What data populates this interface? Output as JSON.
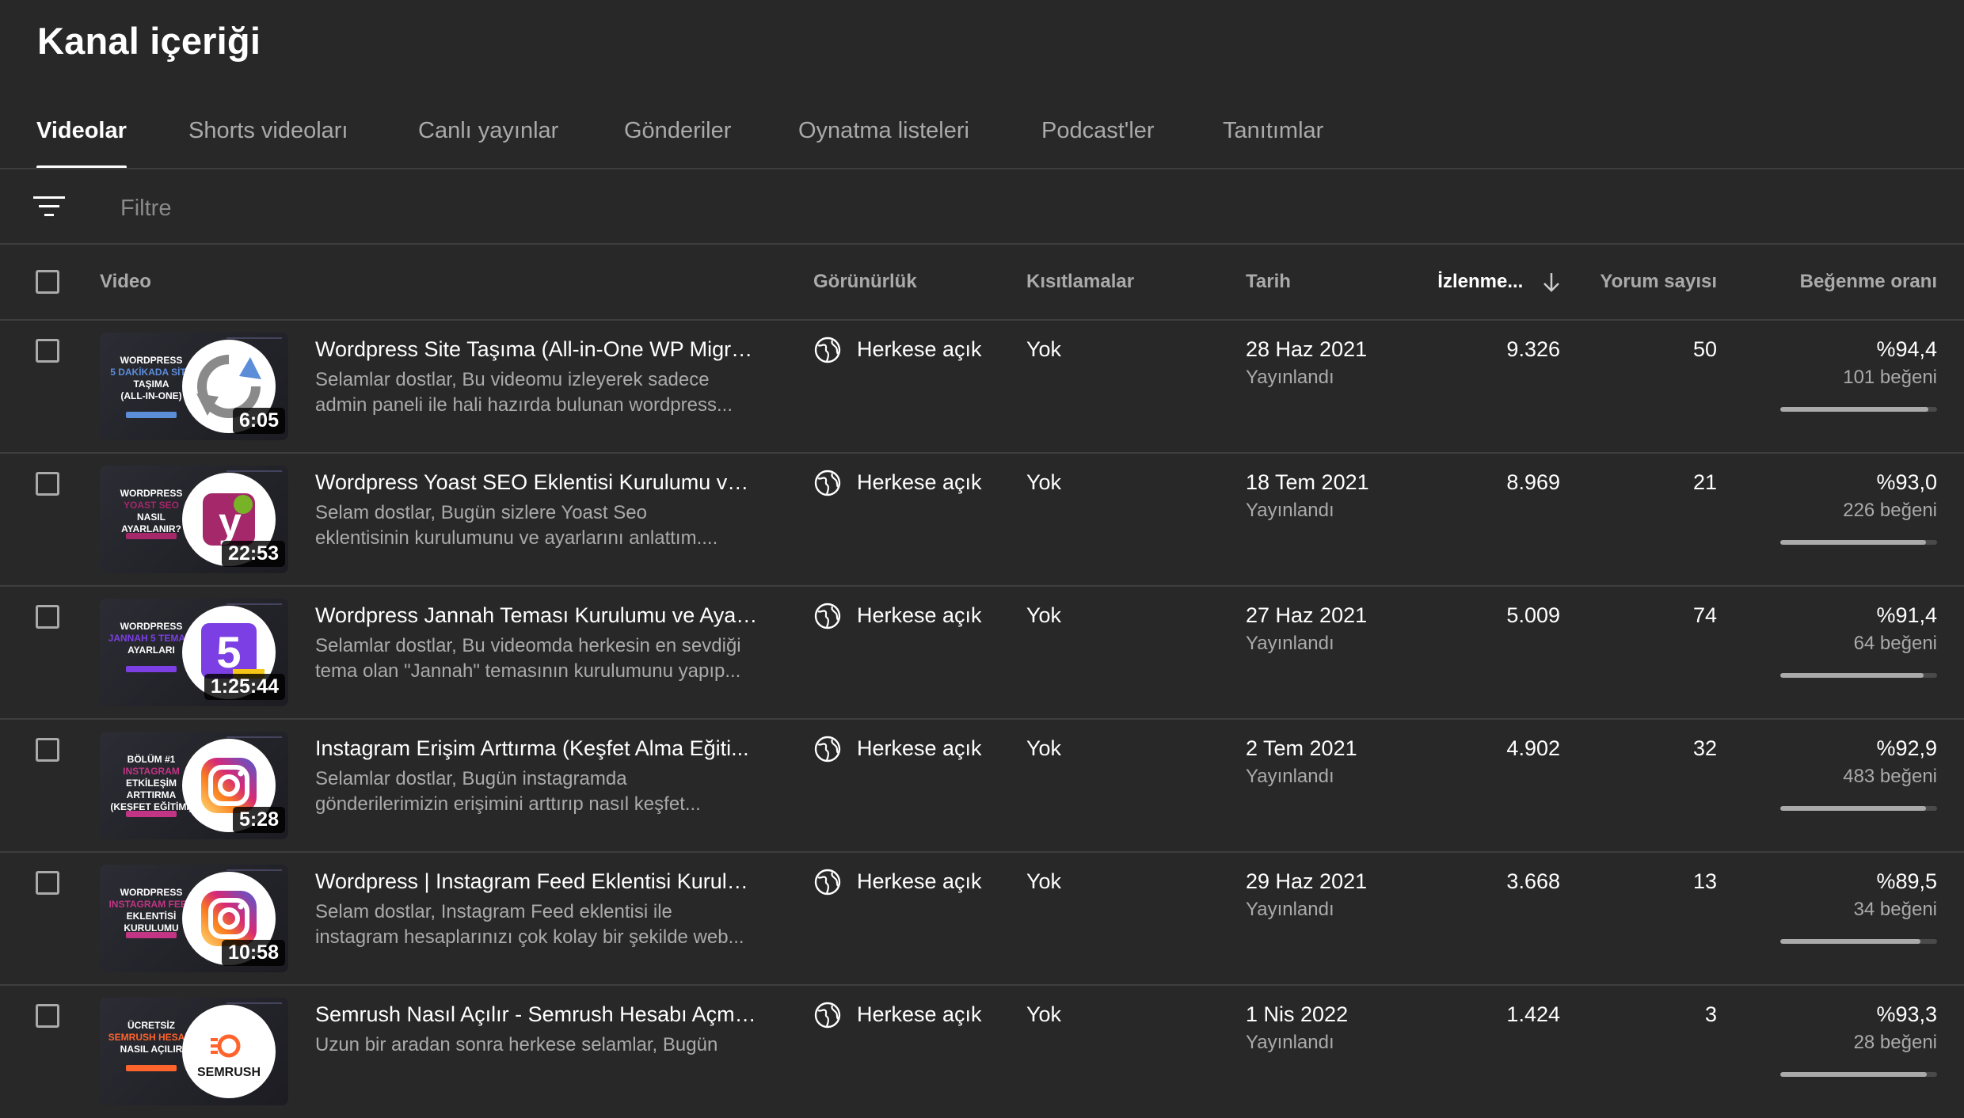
{
  "page": {
    "title": "Kanal içeriği"
  },
  "tabs": [
    {
      "label": "Videolar",
      "active": true
    },
    {
      "label": "Shorts videoları",
      "active": false
    },
    {
      "label": "Canlı yayınlar",
      "active": false
    },
    {
      "label": "Gönderiler",
      "active": false
    },
    {
      "label": "Oynatma listeleri",
      "active": false
    },
    {
      "label": "Podcast'ler",
      "active": false
    },
    {
      "label": "Tanıtımlar",
      "active": false
    }
  ],
  "filter": {
    "placeholder": "Filtre",
    "icon": "filter-icon"
  },
  "table": {
    "headers": {
      "video": "Video",
      "visibility": "Görünürlük",
      "restrictions": "Kısıtlamalar",
      "date": "Tarih",
      "views": "İzlenme...",
      "comments": "Yorum sayısı",
      "likes": "Beğenme oranı"
    },
    "sort": {
      "column": "views",
      "direction": "descending",
      "icon": "arrow-down-icon"
    },
    "rows": [
      {
        "thumb_caption": [
          "WORDPRESS",
          "5 DAKİKADA SİTE",
          "TAŞIMA",
          "(ALL-IN-ONE)"
        ],
        "thumb_icon": "migration-arrows-icon",
        "thumb_accent": "#5b8dd9",
        "duration": "6:05",
        "title": "Wordpress Site Taşıma (All-in-One WP Migrati...",
        "description": [
          "Selamlar dostlar, Bu videomu izleyerek sadece",
          "admin paneli ile hali hazırda bulunan wordpress..."
        ],
        "visibility": "Herkese açık",
        "restrictions": "Yok",
        "date": "28 Haz 2021",
        "status": "Yayınlandı",
        "views": "9.326",
        "comments": "50",
        "like_ratio": "%94,4",
        "likes": "101 beğeni",
        "like_fraction": 0.944
      },
      {
        "thumb_caption": [
          "WORDPRESS",
          "YOAST SEO",
          "NASIL AYARLANIR?"
        ],
        "thumb_icon": "yoast-logo-icon",
        "thumb_accent": "#a4286a",
        "duration": "22:53",
        "title": "Wordpress Yoast SEO Eklentisi Kurulumu ve A...",
        "description": [
          "Selam dostlar, Bugün sizlere Yoast Seo",
          "eklentisinin kurulumunu ve ayarlarını anlattım...."
        ],
        "visibility": "Herkese açık",
        "restrictions": "Yok",
        "date": "18 Tem 2021",
        "status": "Yayınlandı",
        "views": "8.969",
        "comments": "21",
        "like_ratio": "%93,0",
        "likes": "226 beğeni",
        "like_fraction": 0.93
      },
      {
        "thumb_caption": [
          "WORDPRESS",
          "JANNAH 5 TEMASI",
          "AYARLARI"
        ],
        "thumb_icon": "jannah-logo-icon",
        "thumb_accent": "#7b3fe4",
        "duration": "1:25:44",
        "title": "Wordpress Jannah Teması Kurulumu ve Ayarl...",
        "description": [
          "Selamlar dostlar, Bu videomda herkesin en sevdiği",
          "tema olan \"Jannah\" temasının kurulumunu yapıp..."
        ],
        "visibility": "Herkese açık",
        "restrictions": "Yok",
        "date": "27 Haz 2021",
        "status": "Yayınlandı",
        "views": "5.009",
        "comments": "74",
        "like_ratio": "%91,4",
        "likes": "64 beğeni",
        "like_fraction": 0.914
      },
      {
        "thumb_caption": [
          "BÖLÜM #1",
          "INSTAGRAM",
          "ETKİLEŞİM ARTTIRMA",
          "(KEŞFET EĞİTİMİ)"
        ],
        "thumb_icon": "instagram-logo-icon",
        "thumb_accent": "#c13584",
        "duration": "5:28",
        "title": "Instagram Erişim Arttırma (Keşfet Alma Eğiti...",
        "description": [
          "Selamlar dostlar, Bugün instagramda",
          "gönderilerimizin erişimini arttırıp nasıl keşfet..."
        ],
        "visibility": "Herkese açık",
        "restrictions": "Yok",
        "date": "2 Tem 2021",
        "status": "Yayınlandı",
        "views": "4.902",
        "comments": "32",
        "like_ratio": "%92,9",
        "likes": "483 beğeni",
        "like_fraction": 0.929
      },
      {
        "thumb_caption": [
          "WORDPRESS",
          "INSTAGRAM FEED",
          "EKLENTİSİ KURULUMU"
        ],
        "thumb_icon": "instagram-logo-icon",
        "thumb_accent": "#c13584",
        "duration": "10:58",
        "title": "Wordpress | Instagram Feed Eklentisi Kurulum...",
        "description": [
          "Selam dostlar, Instagram Feed eklentisi ile",
          "instagram hesaplarınızı çok kolay bir şekilde web..."
        ],
        "visibility": "Herkese açık",
        "restrictions": "Yok",
        "date": "29 Haz 2021",
        "status": "Yayınlandı",
        "views": "3.668",
        "comments": "13",
        "like_ratio": "%89,5",
        "likes": "34 beğeni",
        "like_fraction": 0.895
      },
      {
        "thumb_caption": [
          "ÜCRETSİZ",
          "SEMRUSH HESABI",
          "NASIL AÇILIR"
        ],
        "thumb_icon": "semrush-logo-icon",
        "thumb_accent": "#ff642d",
        "duration": "",
        "title": "Semrush Nasıl Açılır - Semrush Hesabı Açma ...",
        "description": [
          "Uzun bir aradan sonra herkese selamlar, Bugün",
          ""
        ],
        "visibility": "Herkese açık",
        "restrictions": "Yok",
        "date": "1 Nis 2022",
        "status": "Yayınlandı",
        "views": "1.424",
        "comments": "3",
        "like_ratio": "%93,3",
        "likes": "28 beğeni",
        "like_fraction": 0.933
      }
    ]
  },
  "colors": {
    "background": "#282828",
    "divider": "#3e3e3e",
    "muted_text": "#aaaaaa"
  }
}
